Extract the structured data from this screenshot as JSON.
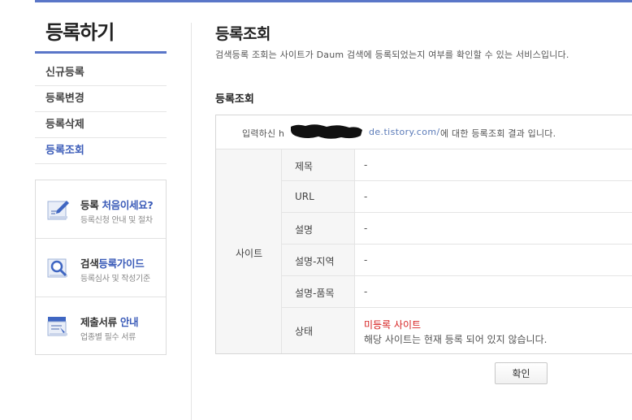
{
  "sidebar": {
    "title": "등록하기",
    "menu": [
      {
        "label": "신규등록"
      },
      {
        "label": "등록변경"
      },
      {
        "label": "등록삭제"
      },
      {
        "label": "등록조회"
      }
    ],
    "promos": [
      {
        "title_prefix": "등록 ",
        "title_highlight": "처음이세요?",
        "title_suffix": "",
        "subtitle": "등록신청 안내 및 절차",
        "icon": "pencil-document-icon"
      },
      {
        "title_prefix": "검색",
        "title_highlight": "등록가이드",
        "title_suffix": "",
        "subtitle": "등록심사 및 작성기준",
        "icon": "magnifier-document-icon"
      },
      {
        "title_prefix": "제출서류 ",
        "title_highlight": "안내",
        "title_suffix": "",
        "subtitle": "업종별 필수 서류",
        "icon": "document-stack-icon"
      }
    ]
  },
  "main": {
    "title": "등록조회",
    "description": "검색등록 조회는 사이트가 Daum 검색에 등록되었는지 여부를 확인할 수 있는 서비스입니다.",
    "section_title": "등록조회",
    "intro_prefix": "입력하신 h",
    "intro_url": "de.tistory.com/",
    "intro_suffix": "에 대한 등록조회 결과 입니다.",
    "group_label": "사이트",
    "rows": [
      {
        "label": "제목",
        "value": "-"
      },
      {
        "label": "URL",
        "value": "-"
      },
      {
        "label": "설명",
        "value": "-"
      },
      {
        "label": "설명-지역",
        "value": "-"
      },
      {
        "label": "설명-품목",
        "value": "-"
      },
      {
        "label": "상태",
        "status": "미등록 사이트",
        "status_detail": "해당 사이트는 현재 등록 되어 있지 않습니다."
      }
    ],
    "confirm_label": "확인"
  },
  "colors": {
    "accent": "#5a76c8",
    "active_menu": "#3a5bb8",
    "status_red": "#d62020"
  }
}
